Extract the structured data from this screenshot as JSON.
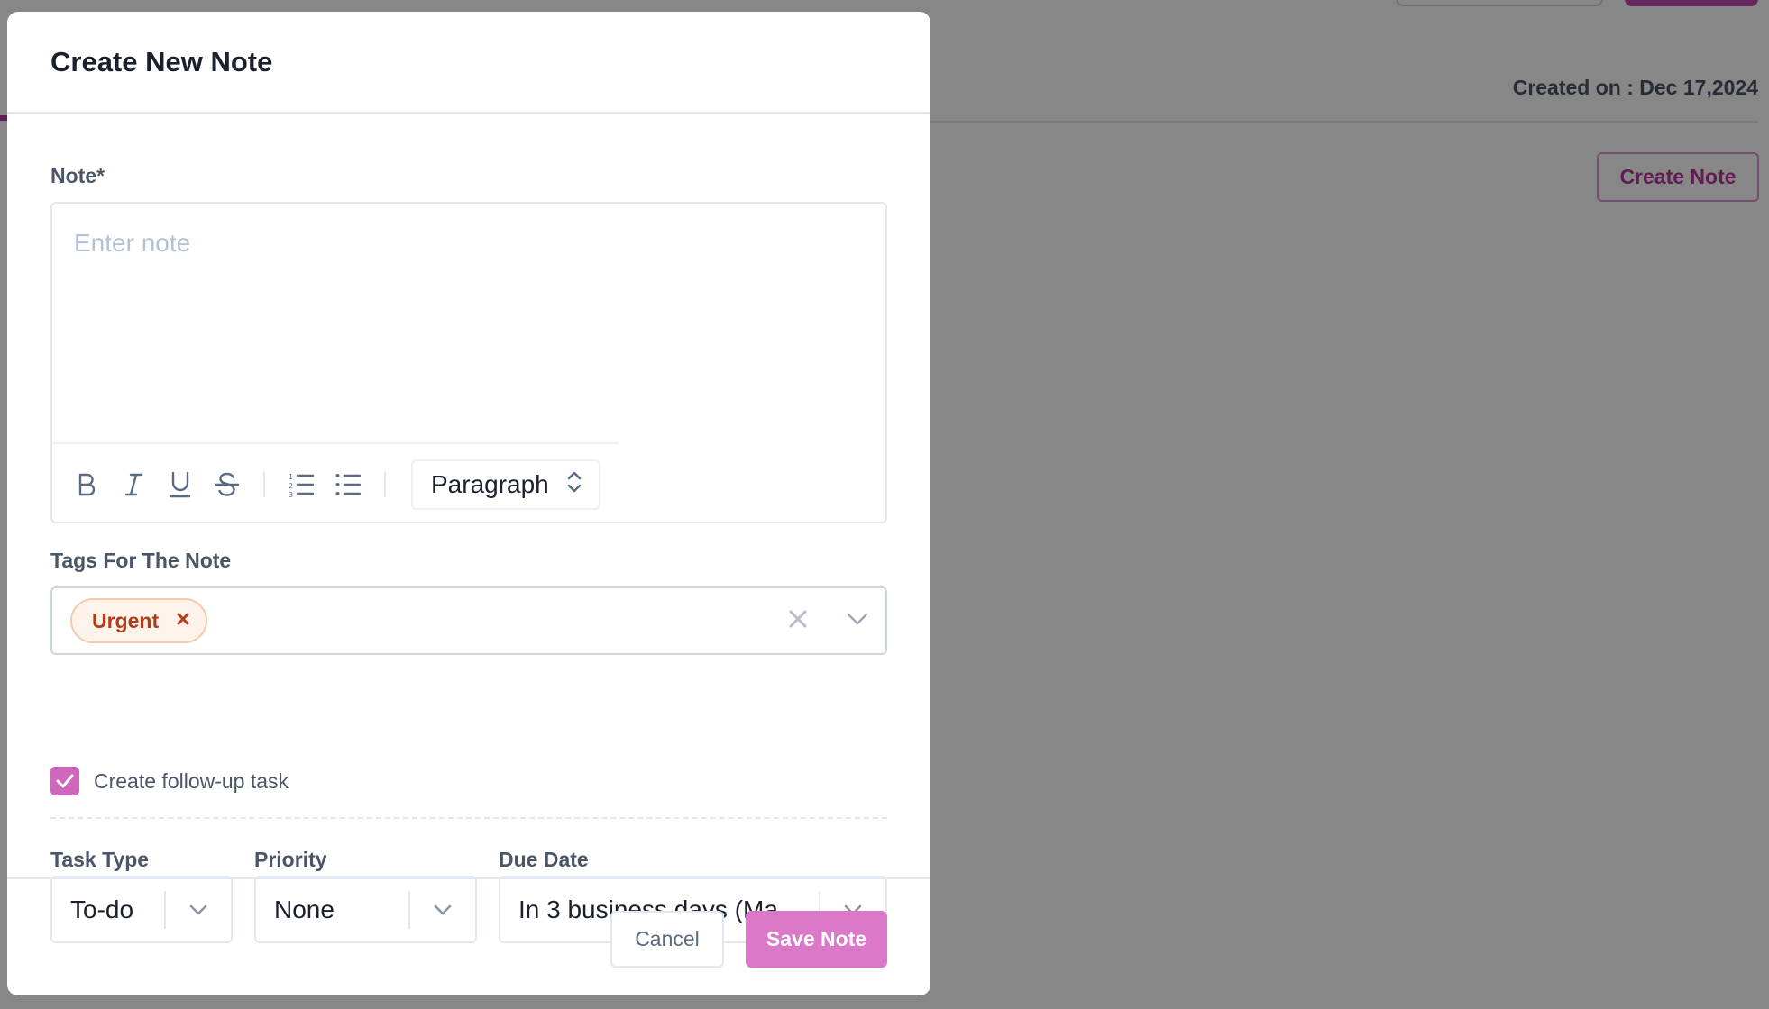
{
  "background": {
    "created_on": "Created on : Dec 17,2024",
    "create_note_button": "Create Note"
  },
  "modal": {
    "title": "Create New Note",
    "note": {
      "label": "Note*",
      "placeholder": "Enter note",
      "toolbar": {
        "icons": [
          "bold-icon",
          "italic-icon",
          "underline-icon",
          "strikethrough-icon",
          "ordered-list-icon",
          "bullet-list-icon"
        ],
        "block_format": "Paragraph"
      }
    },
    "tags": {
      "label": "Tags For The Note",
      "selected": [
        "Urgent"
      ]
    },
    "follow_up": {
      "label": "Create follow-up task",
      "checked": true
    },
    "task_type": {
      "label": "Task Type",
      "value": "To-do"
    },
    "priority": {
      "label": "Priority",
      "value": "None"
    },
    "due_date": {
      "label": "Due Date",
      "value": "In 3 business days (Ma..."
    },
    "footer": {
      "cancel": "Cancel",
      "save": "Save Note"
    }
  },
  "colors": {
    "accent": "#dc78c8",
    "checkbox": "#cd68bc",
    "tag_text": "#b13c18",
    "tag_bg": "#fdf3ea"
  }
}
